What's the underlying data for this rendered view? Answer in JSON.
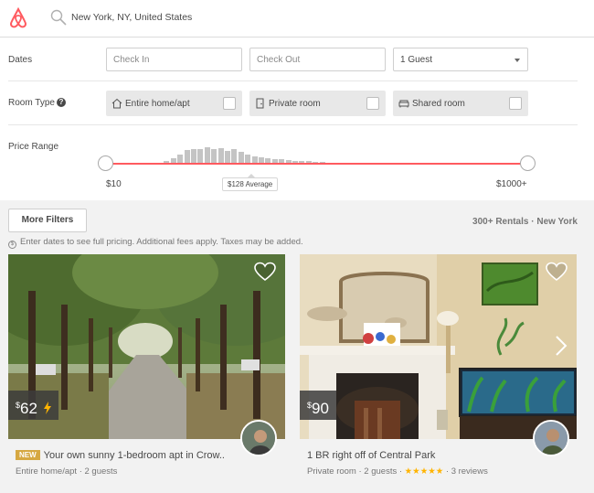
{
  "header": {
    "location": "New York, NY, United States"
  },
  "filters": {
    "dates_label": "Dates",
    "check_in_placeholder": "Check In",
    "check_out_placeholder": "Check Out",
    "guests_value": "1 Guest",
    "room_type_label": "Room Type",
    "room_types": [
      {
        "label": "Entire home/apt",
        "icon": "home-icon",
        "checked": false
      },
      {
        "label": "Private room",
        "icon": "door-icon",
        "checked": false
      },
      {
        "label": "Shared room",
        "icon": "sofa-icon",
        "checked": false
      }
    ],
    "price_range_label": "Price Range",
    "price_min": "$10",
    "price_max": "$1000+",
    "price_average": "$128 Average",
    "histogram": [
      0.1,
      0.2,
      0.35,
      0.55,
      0.8,
      0.85,
      0.85,
      0.95,
      0.85,
      0.9,
      0.75,
      0.85,
      0.7,
      0.55,
      0.45,
      0.4,
      0.35,
      0.3,
      0.3,
      0.25,
      0.2,
      0.2,
      0.2,
      0.15,
      0.15,
      0.1,
      0.1,
      0.1,
      0.1,
      0.1
    ]
  },
  "results": {
    "more_filters_label": "More Filters",
    "count": "300+ Rentals · New York",
    "notice": "Enter dates to see full pricing. Additional fees apply. Taxes may be added.",
    "listings": [
      {
        "price_currency": "$",
        "price": "62",
        "instant_book": true,
        "badge": "NEW",
        "title": "Your own sunny 1-bedroom apt in Crow..",
        "subtitle": "Entire home/apt · 2 guests",
        "stars": "",
        "reviews": ""
      },
      {
        "price_currency": "$",
        "price": "90",
        "instant_book": false,
        "badge": "",
        "title": "1 BR right off of Central Park",
        "subtitle": "Private room · 2 guests · ",
        "stars": "★★★★★",
        "reviews": " · 3 reviews"
      }
    ]
  },
  "colors": {
    "brand": "#ff5a5f",
    "badge": "#d6a842",
    "stars": "#ffb400"
  }
}
